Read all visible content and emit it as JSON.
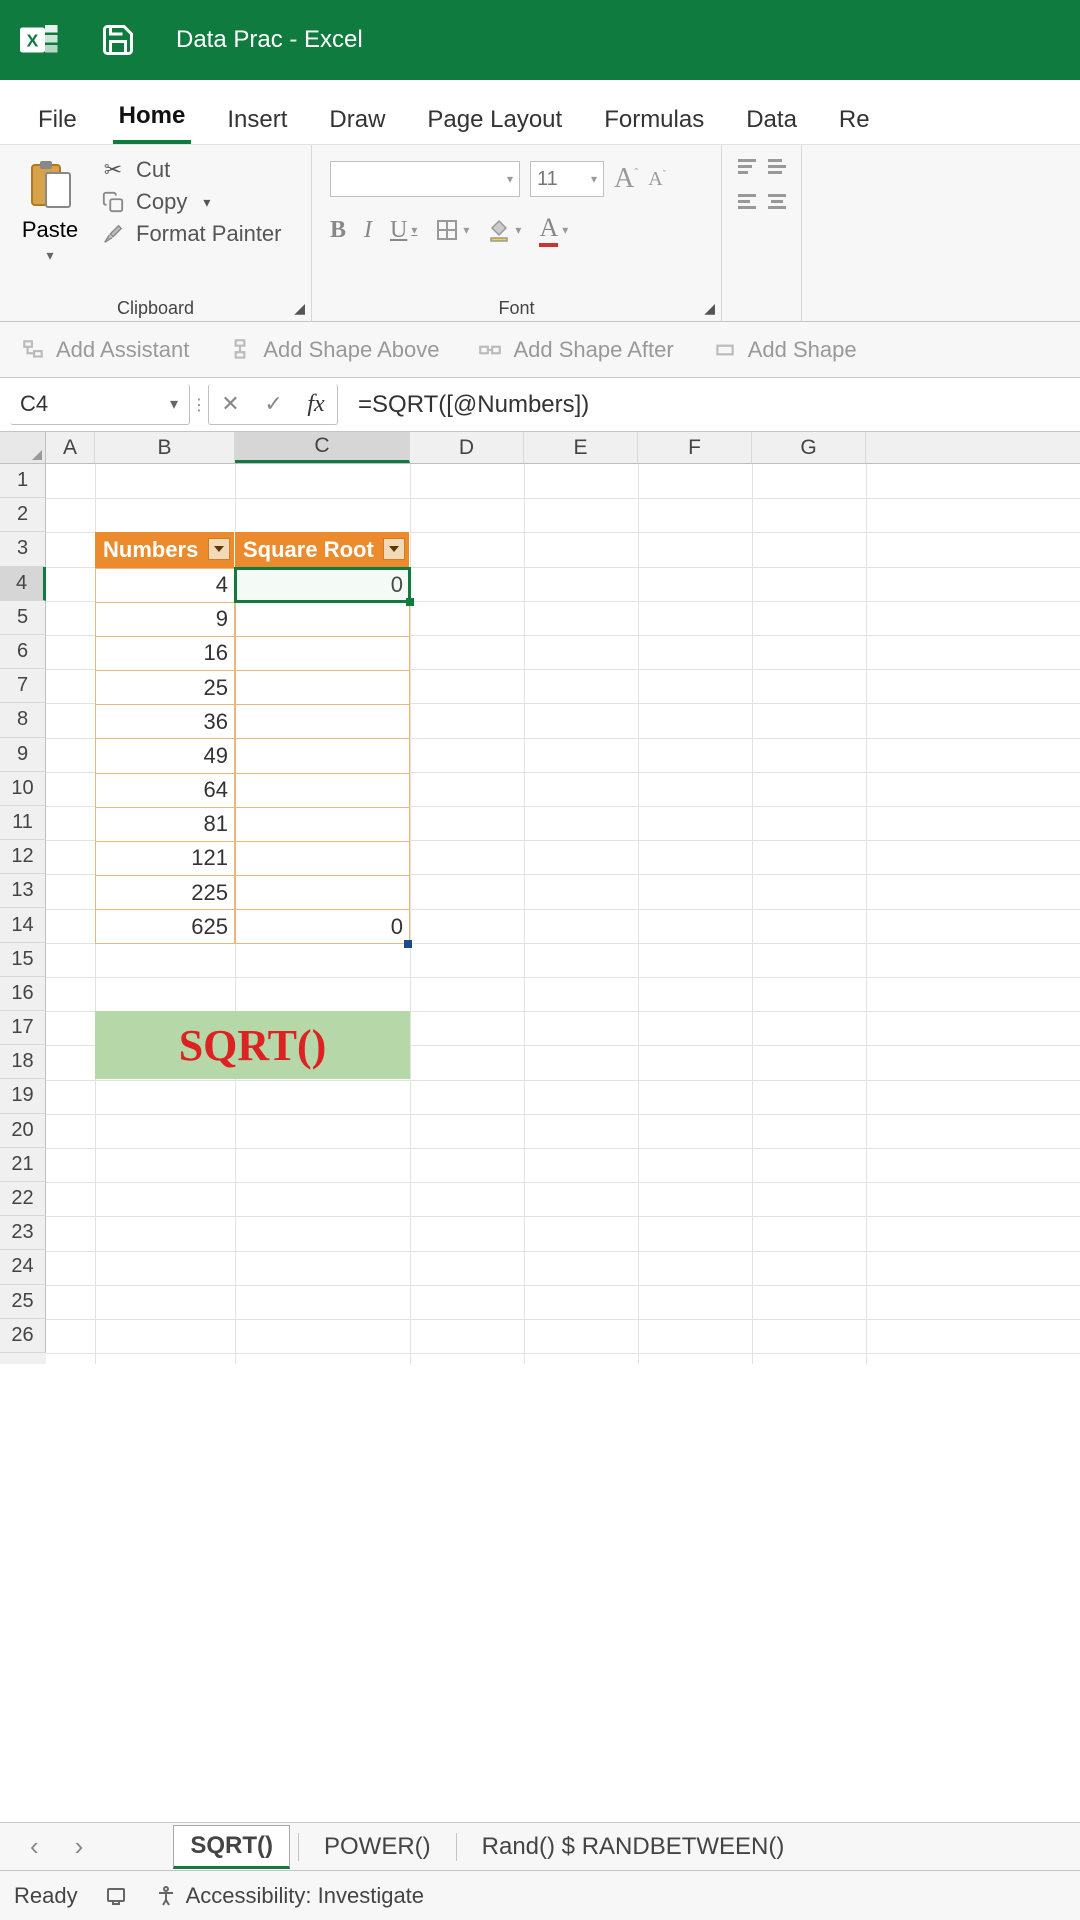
{
  "title": "Data Prac  -  Excel",
  "tabs": [
    "File",
    "Home",
    "Insert",
    "Draw",
    "Page Layout",
    "Formulas",
    "Data",
    "Re"
  ],
  "active_tab": "Home",
  "ribbon": {
    "clipboard": {
      "group_label": "Clipboard",
      "paste": "Paste",
      "cut": "Cut",
      "copy": "Copy",
      "format_painter": "Format Painter"
    },
    "font": {
      "group_label": "Font",
      "size": "11"
    },
    "smartart": {
      "add_assistant": "Add Assistant",
      "add_above": "Add Shape Above",
      "add_after": "Add Shape After",
      "add_shape": "Add Shape"
    }
  },
  "formula_bar": {
    "cell_ref": "C4",
    "formula": "=SQRT([@Numbers])"
  },
  "columns": [
    "A",
    "B",
    "C",
    "D",
    "E",
    "F",
    "G"
  ],
  "selected_col": "C",
  "rows": [
    "1",
    "2",
    "3",
    "4",
    "5",
    "6",
    "7",
    "8",
    "9",
    "10",
    "11",
    "12",
    "13",
    "14",
    "15",
    "16",
    "17",
    "18",
    "19",
    "20",
    "21",
    "22",
    "23",
    "24",
    "25",
    "26"
  ],
  "selected_row": "4",
  "table": {
    "header_b": "Numbers",
    "header_c": "Square Root",
    "numbers": [
      "4",
      "9",
      "16",
      "25",
      "36",
      "49",
      "64",
      "81",
      "121",
      "225",
      "625"
    ],
    "c4_value": "0",
    "c14_value": "0"
  },
  "note_text": "SQRT()",
  "sheet_tabs": {
    "active": "SQRT()",
    "t1": "SQRT()",
    "t2": "POWER()",
    "t3": "Rand() $ RANDBETWEEN()"
  },
  "status": {
    "ready": "Ready",
    "accessibility": "Accessibility: Investigate"
  },
  "chart_data": {
    "type": "table",
    "columns": [
      "Numbers",
      "Square Root"
    ],
    "rows": [
      {
        "Numbers": 4,
        "Square Root": 0
      },
      {
        "Numbers": 9,
        "Square Root": null
      },
      {
        "Numbers": 16,
        "Square Root": null
      },
      {
        "Numbers": 25,
        "Square Root": null
      },
      {
        "Numbers": 36,
        "Square Root": null
      },
      {
        "Numbers": 49,
        "Square Root": null
      },
      {
        "Numbers": 64,
        "Square Root": null
      },
      {
        "Numbers": 81,
        "Square Root": null
      },
      {
        "Numbers": 121,
        "Square Root": null
      },
      {
        "Numbers": 225,
        "Square Root": null
      },
      {
        "Numbers": 625,
        "Square Root": 0
      }
    ]
  }
}
